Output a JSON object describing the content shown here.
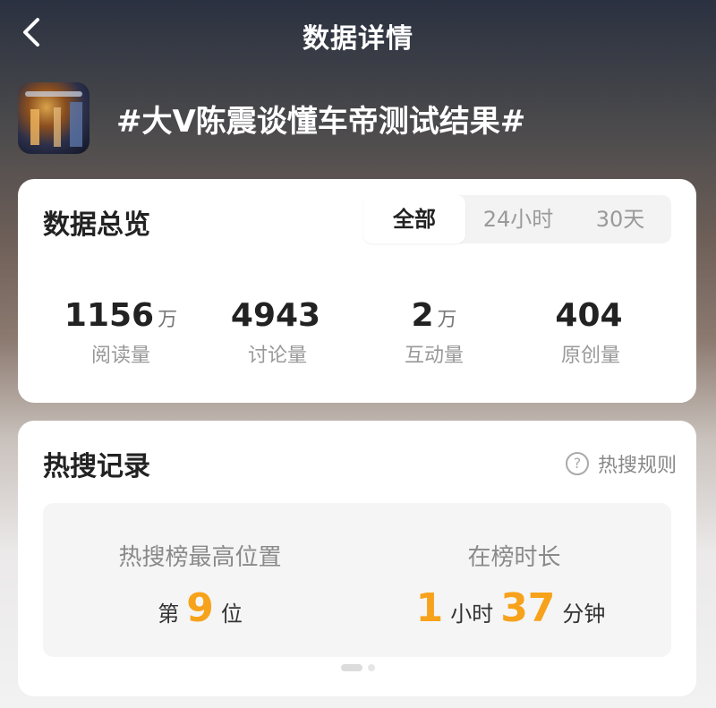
{
  "header": {
    "title": "数据详情"
  },
  "topic": {
    "title": "#大V陈震谈懂车帝测试结果#"
  },
  "overview": {
    "title": "数据总览",
    "tabs": [
      "全部",
      "24小时",
      "30天"
    ],
    "selected_tab": "全部",
    "stats": [
      {
        "value": "1156",
        "unit": "万",
        "label": "阅读量"
      },
      {
        "value": "4943",
        "unit": "",
        "label": "讨论量"
      },
      {
        "value": "2",
        "unit": "万",
        "label": "互动量"
      },
      {
        "value": "404",
        "unit": "",
        "label": "原创量"
      }
    ]
  },
  "hot": {
    "title": "热搜记录",
    "rule_label": "热搜规则",
    "rule_icon": "?",
    "highest_position": {
      "label": "热搜榜最高位置",
      "prefix": "第",
      "value": "9",
      "suffix": "位"
    },
    "duration": {
      "label": "在榜时长",
      "hours": "1",
      "hours_unit": "小时",
      "minutes": "37",
      "minutes_unit": "分钟"
    }
  },
  "colors": {
    "accent": "#f7a21b",
    "card": "#ffffff"
  },
  "icons": {
    "back": "chevron-left-icon",
    "help": "question-circle-icon"
  }
}
